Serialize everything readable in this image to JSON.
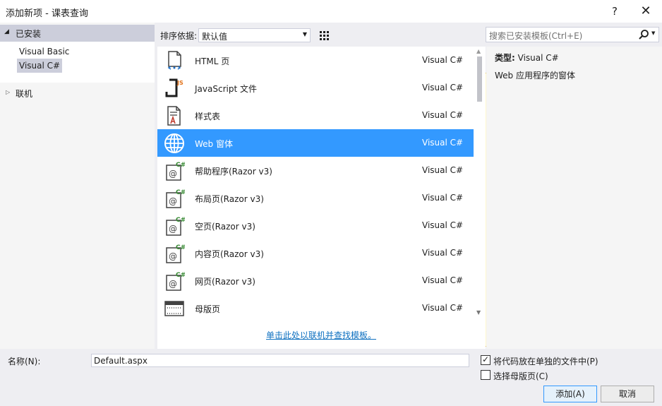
{
  "window": {
    "title": "添加新项 - 课表查询",
    "help_label": "?",
    "close_label": "✕"
  },
  "left_panel": {
    "installed_label": "已安装",
    "installed_items": [
      "Visual Basic",
      "Visual C#"
    ],
    "selected_item": "Visual C#",
    "online_label": "联机"
  },
  "toolbar": {
    "sort_label": "排序依据:",
    "sort_value": "默认值"
  },
  "search": {
    "placeholder": "搜索已安装模板(Ctrl+E)"
  },
  "templates": [
    {
      "name": "HTML 页",
      "language": "Visual C#",
      "icon": "html-page-icon"
    },
    {
      "name": "JavaScript 文件",
      "language": "Visual C#",
      "icon": "javascript-file-icon"
    },
    {
      "name": "样式表",
      "language": "Visual C#",
      "icon": "stylesheet-icon"
    },
    {
      "name": "Web 窗体",
      "language": "Visual C#",
      "icon": "web-form-icon",
      "selected": true
    },
    {
      "name": "帮助程序(Razor v3)",
      "language": "Visual C#",
      "icon": "razor-icon"
    },
    {
      "name": "布局页(Razor v3)",
      "language": "Visual C#",
      "icon": "razor-icon"
    },
    {
      "name": "空页(Razor v3)",
      "language": "Visual C#",
      "icon": "razor-icon"
    },
    {
      "name": "内容页(Razor v3)",
      "language": "Visual C#",
      "icon": "razor-icon"
    },
    {
      "name": "网页(Razor v3)",
      "language": "Visual C#",
      "icon": "razor-icon"
    },
    {
      "name": "母版页",
      "language": "Visual C#",
      "icon": "master-page-icon"
    }
  ],
  "online_link": "单击此处以联机并查找模板。",
  "details": {
    "type_label": "类型:",
    "type_value": "Visual C#",
    "description": "Web 应用程序的窗体"
  },
  "bottom": {
    "name_label": "名称(N):",
    "name_value": "Default.aspx",
    "separate_file_label": "将代码放在单独的文件中(P)",
    "separate_file_checked": true,
    "master_page_label": "选择母版页(C)",
    "master_page_checked": false,
    "add_label": "添加(A)",
    "cancel_label": "取消"
  },
  "colors": {
    "selection": "#3399ff",
    "link": "#0e70c0",
    "header_bg": "#cccedb"
  }
}
